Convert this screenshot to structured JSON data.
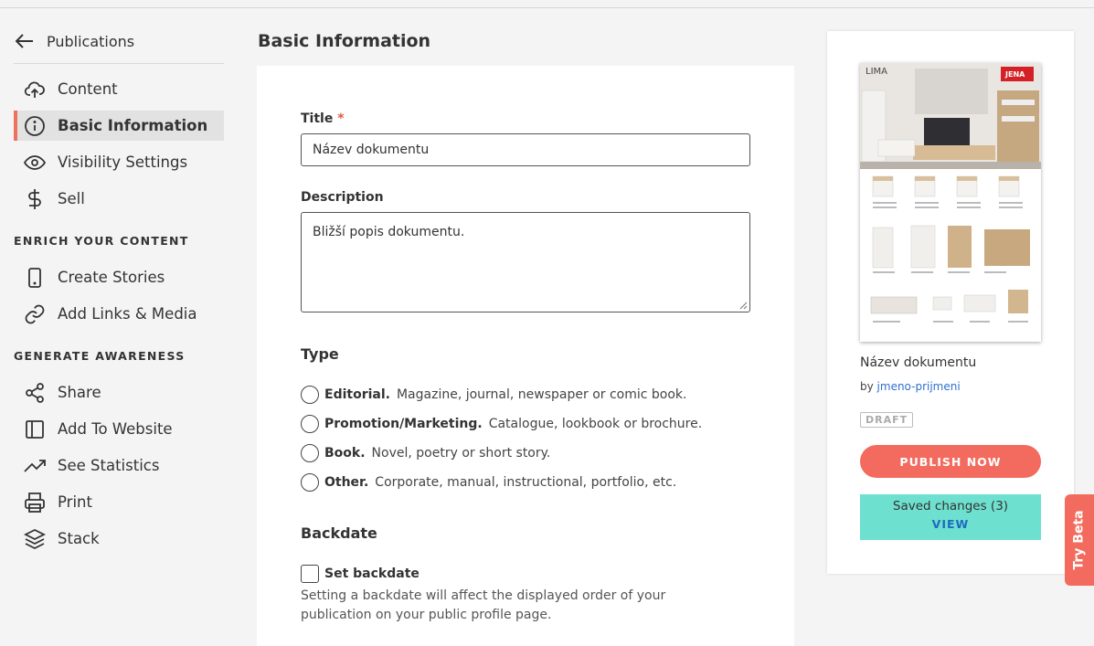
{
  "sidebar": {
    "back_label": "Publications",
    "items": [
      {
        "label": "Content",
        "icon": "cloud-upload-icon"
      },
      {
        "label": "Basic Information",
        "icon": "info-icon"
      },
      {
        "label": "Visibility Settings",
        "icon": "eye-icon"
      },
      {
        "label": "Sell",
        "icon": "dollar-icon"
      }
    ],
    "section_enrich": "ENRICH YOUR CONTENT",
    "enrich_items": [
      {
        "label": "Create Stories",
        "icon": "phone-icon"
      },
      {
        "label": "Add Links & Media",
        "icon": "link-icon"
      }
    ],
    "section_awareness": "GENERATE AWARENESS",
    "awareness_items": [
      {
        "label": "Share",
        "icon": "share-icon"
      },
      {
        "label": "Add To Website",
        "icon": "embed-icon"
      },
      {
        "label": "See Statistics",
        "icon": "trend-icon"
      },
      {
        "label": "Print",
        "icon": "printer-icon"
      },
      {
        "label": "Stack",
        "icon": "layers-icon"
      }
    ]
  },
  "main": {
    "page_title": "Basic Information",
    "title_label": "Title",
    "required_mark": "*",
    "title_value": "Název dokumentu",
    "description_label": "Description",
    "description_value": "Bližší popis dokumentu.",
    "type_heading": "Type",
    "types": [
      {
        "name": "Editorial.",
        "desc": "Magazine, journal, newspaper or comic book."
      },
      {
        "name": "Promotion/Marketing.",
        "desc": "Catalogue, lookbook or brochure."
      },
      {
        "name": "Book.",
        "desc": "Novel, poetry or short story."
      },
      {
        "name": "Other.",
        "desc": "Corporate, manual, instructional, portfolio, etc."
      }
    ],
    "backdate_heading": "Backdate",
    "backdate_checkbox": "Set backdate",
    "backdate_hint": "Setting a backdate will affect the displayed order of your publication on your public profile page."
  },
  "preview": {
    "doc_title": "Název dokumentu",
    "by_prefix": "by",
    "author": "jmeno-prijmeni",
    "status_badge": "DRAFT",
    "publish_button": "PUBLISH NOW",
    "saved_changes": "Saved changes (3)",
    "view_link": "VIEW",
    "cover_label": "LIMA",
    "cover_brand": "JENA"
  },
  "beta_tab": "Try Beta",
  "colors": {
    "accent": "#f26b5e",
    "saved_bg": "#6ee0cf",
    "link": "#2f6fd0"
  }
}
